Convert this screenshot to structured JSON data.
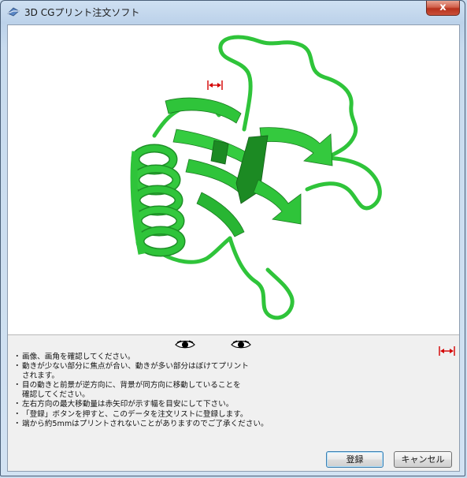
{
  "window": {
    "title": "3D CGプリント注文ソフト",
    "close_label": "x"
  },
  "viewer": {
    "model_color": "#2fc43a",
    "model_dark_color": "#1c8a23",
    "arrow_color": "#d40000"
  },
  "instructions": [
    "画像、画角を確認してください。",
    "動きが少ない部分に焦点が合い、動きが多い部分はぼけてプリント\nされます。",
    "目の動きと前景が逆方向に、背景が同方向に移動していることを\n確認してください。",
    "左右方向の最大移動量は赤矢印が示す幅を目安にして下さい。",
    "「登録」ボタンを押すと、このデータを注文リストに登録します。",
    "端から約5mmはプリントされないことがありますのでご了承ください。"
  ],
  "buttons": {
    "register": "登録",
    "cancel": "キャンセル"
  }
}
